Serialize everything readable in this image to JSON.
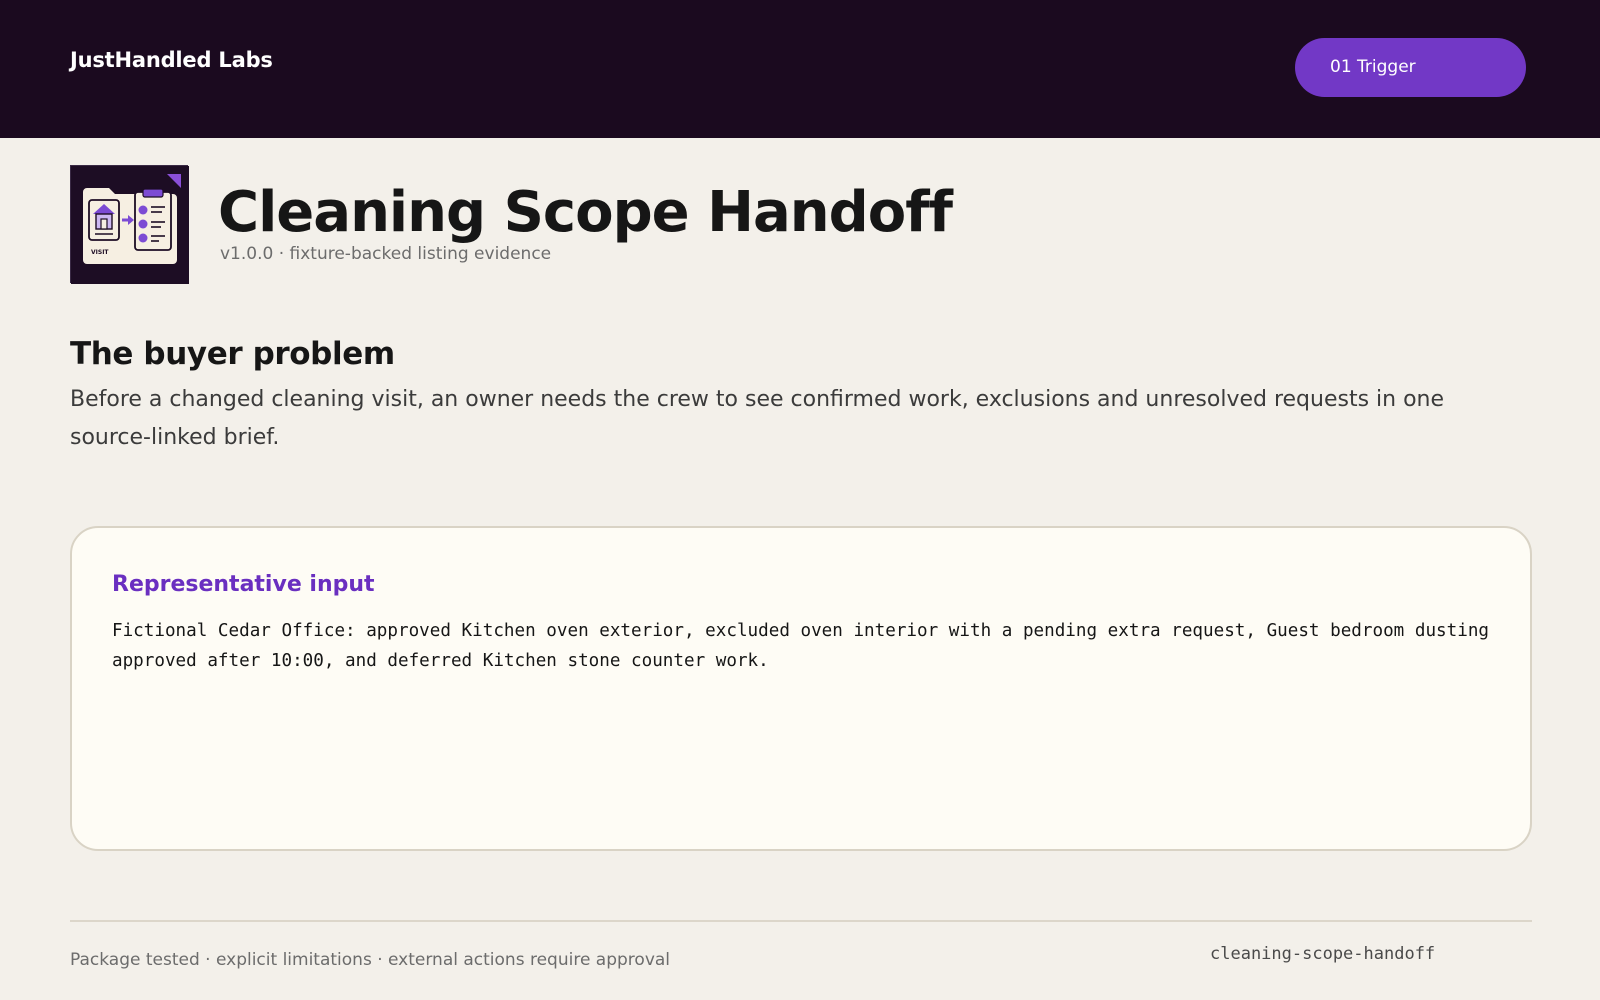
{
  "header": {
    "brand": "JustHandled Labs",
    "trigger_button": "01 Trigger"
  },
  "hero": {
    "logo_icon": "visit-scope-folder-icon",
    "logo_text": "VISIT",
    "title": "Cleaning Scope Handoff",
    "subtitle": "v1.0.0 · fixture-backed listing evidence"
  },
  "problem": {
    "heading": "The buyer problem",
    "text": "Before a changed cleaning visit, an owner needs the crew to see confirmed work, exclusions and unresolved requests in one source-linked brief."
  },
  "input_card": {
    "heading": "Representative input",
    "text": "Fictional Cedar Office: approved Kitchen oven exterior, excluded oven interior with a pending extra request, Guest bedroom dusting approved after 10:00, and deferred Kitchen stone counter work."
  },
  "footer": {
    "text": "Package tested · explicit limitations · external actions require approval",
    "slug": "cleaning-scope-handoff"
  },
  "colors": {
    "topbar": "#1b0a1f",
    "accent": "#7238c6",
    "page_bg": "#f3f0ea",
    "card_bg": "#fefcf5"
  }
}
